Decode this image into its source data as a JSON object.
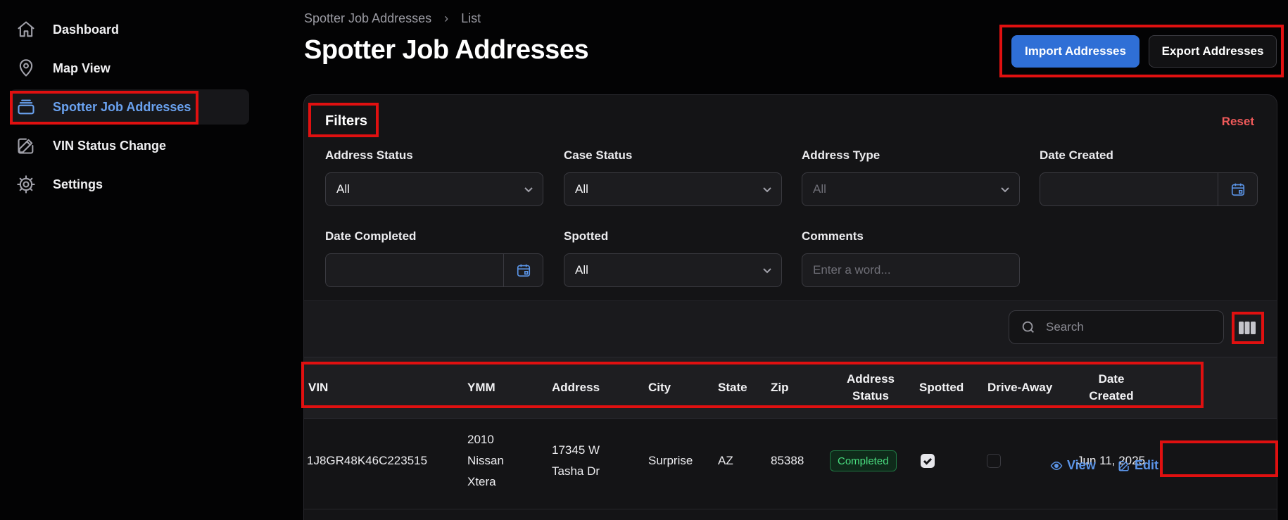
{
  "sidebar": {
    "items": [
      {
        "label": "Dashboard",
        "icon": "home-icon"
      },
      {
        "label": "Map View",
        "icon": "map-pin-icon"
      },
      {
        "label": "Spotter Job Addresses",
        "icon": "layers-icon",
        "active": true
      },
      {
        "label": "VIN Status Change",
        "icon": "edit-icon"
      },
      {
        "label": "Settings",
        "icon": "gear-icon"
      }
    ]
  },
  "header": {
    "breadcrumb": [
      "Spotter Job Addresses",
      "List"
    ],
    "title": "Spotter Job Addresses",
    "import_label": "Import Addresses",
    "export_label": "Export Addresses"
  },
  "filters": {
    "title": "Filters",
    "reset_label": "Reset",
    "address_status": {
      "label": "Address Status",
      "value": "All"
    },
    "case_status": {
      "label": "Case Status",
      "value": "All"
    },
    "address_type": {
      "label": "Address Type",
      "value": "All"
    },
    "date_created": {
      "label": "Date Created",
      "value": ""
    },
    "date_completed": {
      "label": "Date Completed",
      "value": ""
    },
    "spotted": {
      "label": "Spotted",
      "value": "All"
    },
    "comments": {
      "label": "Comments",
      "placeholder": "Enter a word..."
    }
  },
  "search": {
    "placeholder": "Search"
  },
  "table": {
    "columns": [
      "VIN",
      "YMM",
      "Address",
      "City",
      "State",
      "Zip",
      "Address Status",
      "Spotted",
      "Drive-Away",
      "Date Created"
    ],
    "col_address_status_1": "Address",
    "col_address_status_2": "Status",
    "col_date_created_1": "Date",
    "col_date_created_2": "Created",
    "rows": [
      {
        "vin": "1J8GR48K46C223515",
        "ymm": [
          "2010",
          "Nissan",
          "Xtera"
        ],
        "address": [
          "17345 W",
          "Tasha Dr"
        ],
        "city": "Surprise",
        "state": "AZ",
        "zip": "85388",
        "status": "Completed",
        "spotted": true,
        "drive_away": false,
        "date_created": "Jun 11, 2025",
        "view_label": "View",
        "edit_label": "Edit"
      }
    ]
  },
  "colors": {
    "accent": "#2f6fd6",
    "link": "#5b95e8",
    "reset": "#f05a5a",
    "success": "#4ade80",
    "highlight": "#e01010"
  }
}
